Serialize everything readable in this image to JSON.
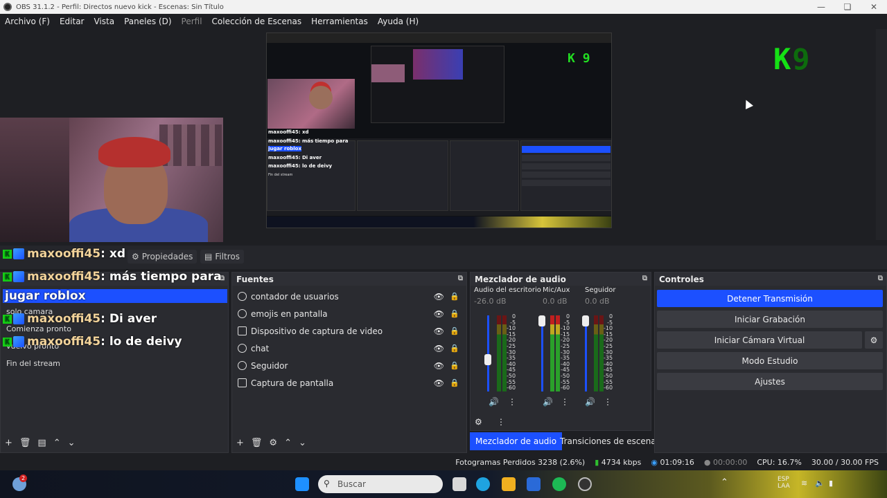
{
  "window": {
    "title": "OBS 31.1.2 - Perfil: Directos nuevo kick - Escenas: Sin Título"
  },
  "menu": [
    "Archivo (F)",
    "Editar",
    "Vista",
    "Paneles (D)",
    "Perfil",
    "Colección de Escenas",
    "Herramientas",
    "Ayuda (H)"
  ],
  "preview_overlay": {
    "kick_logo": "K",
    "kick_number": "9"
  },
  "props": {
    "propiedades": "Propiedades",
    "filtros": "Filtros"
  },
  "chat": [
    {
      "user": "maxooffi45",
      "text": ": xd"
    },
    {
      "user": "maxooffi45",
      "text": ": más tiempo para"
    },
    {
      "continuation": "jugar roblox"
    },
    {
      "user": "maxooffi45",
      "text": ": Di aver"
    },
    {
      "user": "maxooffi45",
      "text": ": lo de deivy"
    }
  ],
  "scenes": {
    "items": [
      "solo camara",
      "Comienza pronto",
      "vuelvo pronto",
      "Fin del stream"
    ]
  },
  "sources": {
    "title": "Fuentes",
    "items": [
      "contador de usuarios",
      "emojis en pantalla",
      "Dispositivo de captura de video",
      "chat",
      "Seguidor",
      "Captura de pantalla"
    ]
  },
  "mixer": {
    "title": "Mezclador de audio",
    "channels": [
      {
        "name": "Audio del escritorio",
        "db": "-26.0 dB",
        "level": 0.4
      },
      {
        "name": "Mic/Aux",
        "db": "0.0 dB",
        "level": 1.0
      },
      {
        "name": "Seguidor",
        "db": "0.0 dB",
        "level": 1.0
      }
    ],
    "scale": [
      "0",
      "-5",
      "-10",
      "-15",
      "-20",
      "-25",
      "-30",
      "-35",
      "-40",
      "-45",
      "-50",
      "-55",
      "-60"
    ],
    "tabs": [
      "Mezclador de audio",
      "Transiciones de escena"
    ]
  },
  "controls": {
    "title": "Controles",
    "buttons": [
      "Detener Transmisión",
      "Iniciar Grabación",
      "Iniciar Cámara Virtual",
      "Modo Estudio",
      "Ajustes"
    ]
  },
  "status": {
    "frames": "Fotogramas Perdidos 3238 (2.6%)",
    "bitrate": "4734 kbps",
    "stream_time": "01:09:16",
    "rec_time": "00:00:00",
    "cpu": "CPU: 16.7%",
    "fps": "30.00 / 30.00 FPS"
  },
  "taskbar": {
    "search_placeholder": "Buscar",
    "notif_badge": "2",
    "lang": "ESP",
    "lang2": "LAA"
  },
  "colors": {
    "accent": "#1c50ff",
    "kick_green": "#15e015",
    "panel": "#2a2b30"
  }
}
